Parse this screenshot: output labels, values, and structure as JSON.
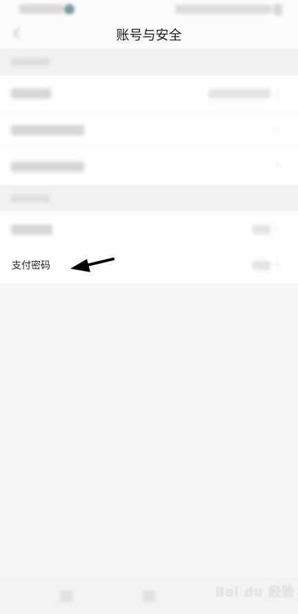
{
  "header": {
    "title": "账号与安全"
  },
  "rows": {
    "pay_password": {
      "label": "支付密码"
    }
  },
  "watermark": {
    "text": "Bai du 经验"
  }
}
